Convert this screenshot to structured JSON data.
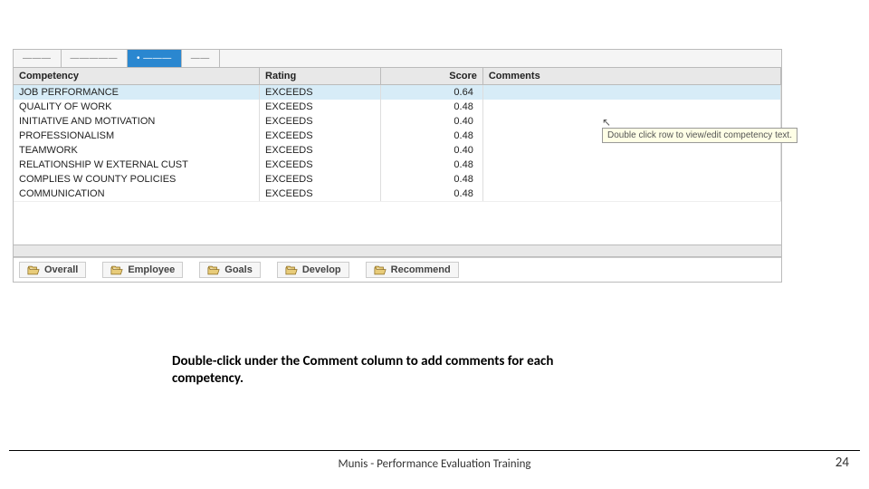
{
  "top_tabs": {
    "seg1": "———",
    "seg2": "—————",
    "seg3": "• ———",
    "seg4": "——"
  },
  "headers": {
    "competency": "Competency",
    "rating": "Rating",
    "score": "Score",
    "comments": "Comments"
  },
  "rows": [
    {
      "competency": "JOB PERFORMANCE",
      "rating": "EXCEEDS",
      "score": "0.64",
      "comments": "",
      "selected": true
    },
    {
      "competency": "QUALITY OF WORK",
      "rating": "EXCEEDS",
      "score": "0.48",
      "comments": ""
    },
    {
      "competency": "INITIATIVE AND MOTIVATION",
      "rating": "EXCEEDS",
      "score": "0.40",
      "comments": ""
    },
    {
      "competency": "PROFESSIONALISM",
      "rating": "EXCEEDS",
      "score": "0.48",
      "comments": ""
    },
    {
      "competency": "TEAMWORK",
      "rating": "EXCEEDS",
      "score": "0.40",
      "comments": ""
    },
    {
      "competency": "RELATIONSHIP W EXTERNAL CUST",
      "rating": "EXCEEDS",
      "score": "0.48",
      "comments": ""
    },
    {
      "competency": "COMPLIES W COUNTY POLICIES",
      "rating": "EXCEEDS",
      "score": "0.48",
      "comments": ""
    },
    {
      "competency": "COMMUNICATION",
      "rating": "EXCEEDS",
      "score": "0.48",
      "comments": ""
    }
  ],
  "tooltip": {
    "cursor": "↖",
    "text": "Double click row to view/edit competency text."
  },
  "bottom_tabs": [
    {
      "label": "Overall"
    },
    {
      "label": "Employee"
    },
    {
      "label": "Goals"
    },
    {
      "label": "Develop"
    },
    {
      "label": "Recommend"
    }
  ],
  "instruction": "Double-click under the Comment column to add comments for each competency.",
  "footer": {
    "title": "Munis - Performance Evaluation Training",
    "page": "24"
  }
}
